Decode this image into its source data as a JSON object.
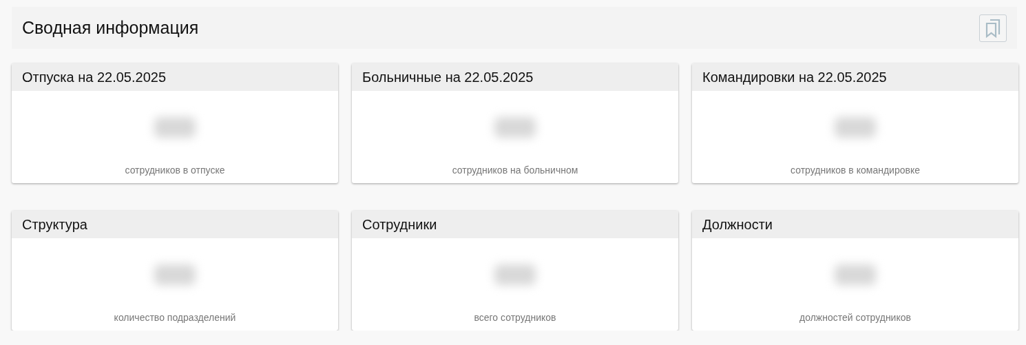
{
  "header": {
    "title": "Сводная информация"
  },
  "cards": [
    {
      "title": "Отпуска на 22.05.2025",
      "kind": "blurred",
      "caption": "сотрудников в отпуске"
    },
    {
      "title": "Больничные на 22.05.2025",
      "kind": "blurred",
      "caption": "сотрудников на больничном"
    },
    {
      "title": "Командировки на 22.05.2025",
      "kind": "blurred",
      "caption": "сотрудников в командировке"
    },
    {
      "title": "Структура",
      "kind": "blurred",
      "caption": "количество подразделений"
    },
    {
      "title": "Сотрудники",
      "kind": "blurred",
      "caption": "всего сотрудников"
    },
    {
      "title": "Должности",
      "kind": "blurred",
      "caption": "должностей сотрудников"
    }
  ]
}
